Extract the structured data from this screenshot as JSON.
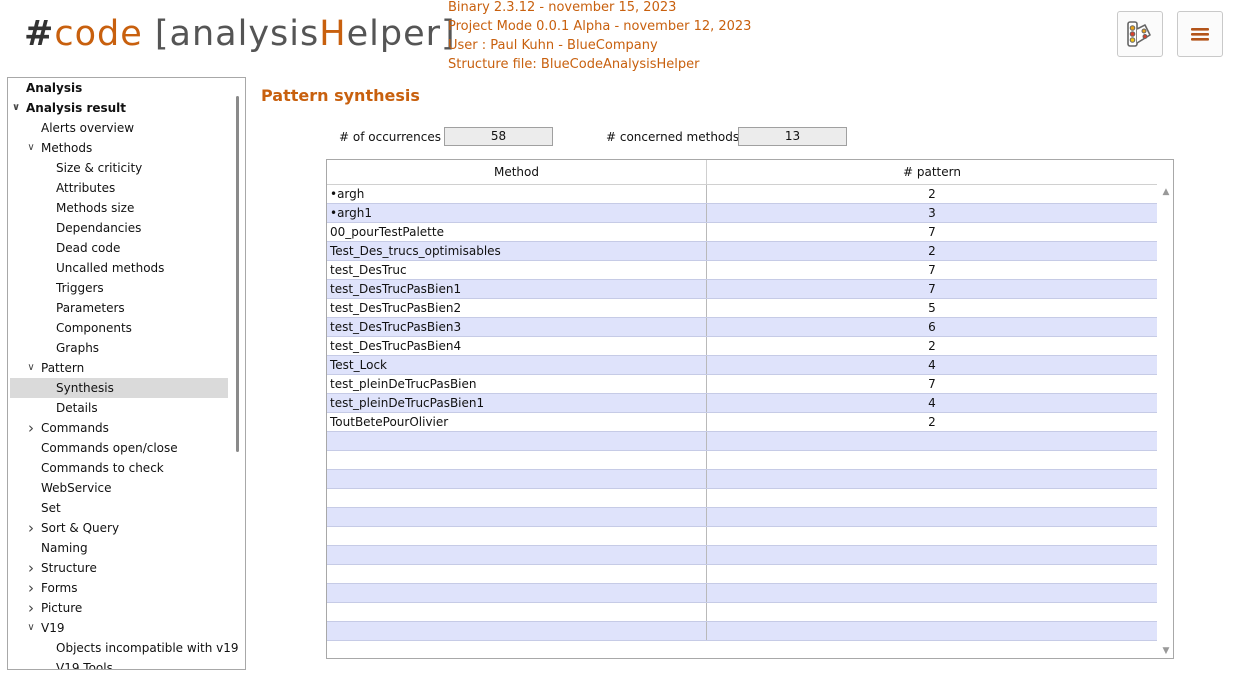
{
  "header": {
    "logo": {
      "hash": "#",
      "code": "code",
      "open_bracket": "[",
      "analysis": "analysis",
      "h": "H",
      "elper": "elper",
      "close_bracket": "]"
    },
    "info_lines": [
      "Binary 2.3.12 - november 15, 2023",
      "Project Mode 0.0.1 Alpha - november 12, 2023",
      "User : Paul Kuhn - BlueCompany",
      "Structure file: BlueCodeAnalysisHelper"
    ],
    "buttons": {
      "palette_icon": "palette-icon",
      "menu_icon": "hamburger-menu-icon"
    },
    "accent_color": "#c8600e"
  },
  "sidebar": {
    "items": [
      {
        "label": "Analysis",
        "level": 0,
        "bold": true,
        "arrow": ""
      },
      {
        "label": "Analysis result",
        "level": 0,
        "bold": true,
        "arrow": "expanded"
      },
      {
        "label": "Alerts overview",
        "level": 1,
        "arrow": ""
      },
      {
        "label": "Methods",
        "level": 1,
        "arrow": "expanded"
      },
      {
        "label": "Size & criticity",
        "level": 2,
        "arrow": ""
      },
      {
        "label": "Attributes",
        "level": 2,
        "arrow": ""
      },
      {
        "label": "Methods size",
        "level": 2,
        "arrow": ""
      },
      {
        "label": "Dependancies",
        "level": 2,
        "arrow": ""
      },
      {
        "label": "Dead code",
        "level": 2,
        "arrow": ""
      },
      {
        "label": "Uncalled methods",
        "level": 2,
        "arrow": ""
      },
      {
        "label": "Triggers",
        "level": 2,
        "arrow": ""
      },
      {
        "label": "Parameters",
        "level": 2,
        "arrow": ""
      },
      {
        "label": "Components",
        "level": 2,
        "arrow": ""
      },
      {
        "label": "Graphs",
        "level": 2,
        "arrow": ""
      },
      {
        "label": "Pattern",
        "level": 1,
        "arrow": "expanded"
      },
      {
        "label": "Synthesis",
        "level": 2,
        "arrow": "",
        "selected": true
      },
      {
        "label": "Details",
        "level": 2,
        "arrow": ""
      },
      {
        "label": "Commands",
        "level": 1,
        "arrow": "collapsed"
      },
      {
        "label": "Commands open/close",
        "level": 1,
        "arrow": ""
      },
      {
        "label": "Commands to check",
        "level": 1,
        "arrow": ""
      },
      {
        "label": "WebService",
        "level": 1,
        "arrow": ""
      },
      {
        "label": "Set",
        "level": 1,
        "arrow": ""
      },
      {
        "label": "Sort & Query",
        "level": 1,
        "arrow": "collapsed"
      },
      {
        "label": "Naming",
        "level": 1,
        "arrow": ""
      },
      {
        "label": "Structure",
        "level": 1,
        "arrow": "collapsed"
      },
      {
        "label": "Forms",
        "level": 1,
        "arrow": "collapsed"
      },
      {
        "label": "Picture",
        "level": 1,
        "arrow": "collapsed"
      },
      {
        "label": "V19",
        "level": 1,
        "arrow": "expanded"
      },
      {
        "label": "Objects incompatible with v19",
        "level": 2,
        "arrow": ""
      },
      {
        "label": "V19 Tools",
        "level": 2,
        "arrow": ""
      }
    ]
  },
  "main": {
    "title": "Pattern synthesis",
    "occurrences_label": "# of occurrences :",
    "occurrences_value": "58",
    "methods_label": "# concerned methods :",
    "methods_value": "13",
    "table": {
      "columns": [
        "Method",
        "# pattern"
      ],
      "rows": [
        [
          "•argh",
          "2"
        ],
        [
          "•argh1",
          "3"
        ],
        [
          "00_pourTestPalette",
          "7"
        ],
        [
          "Test_Des_trucs_optimisables",
          "2"
        ],
        [
          "test_DesTruc",
          "7"
        ],
        [
          "test_DesTrucPasBien1",
          "7"
        ],
        [
          "test_DesTrucPasBien2",
          "5"
        ],
        [
          "test_DesTrucPasBien3",
          "6"
        ],
        [
          "test_DesTrucPasBien4",
          "2"
        ],
        [
          "Test_Lock",
          "4"
        ],
        [
          "test_pleinDeTrucPasBien",
          "7"
        ],
        [
          "test_pleinDeTrucPasBien1",
          "4"
        ],
        [
          "ToutBetePourOlivier",
          "2"
        ]
      ],
      "alt_row_color": "#dfe3fb"
    }
  }
}
